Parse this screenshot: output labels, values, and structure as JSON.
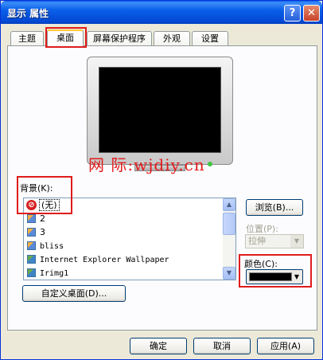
{
  "window": {
    "title": "显示 属性",
    "help_glyph": "?",
    "close_glyph": "✕"
  },
  "tabs": [
    {
      "label": "主题",
      "active": false
    },
    {
      "label": "桌面",
      "active": true
    },
    {
      "label": "屏幕保护程序",
      "active": false
    },
    {
      "label": "外观",
      "active": false
    },
    {
      "label": "设置",
      "active": false
    }
  ],
  "watermark": "网 际:wjdiy.cn",
  "background": {
    "label": "背景(K):",
    "items": [
      {
        "label": "(无)",
        "icon": "no-entry-icon",
        "selected": true
      },
      {
        "label": "2",
        "icon": "image-file-icon"
      },
      {
        "label": "3",
        "icon": "image-file-icon"
      },
      {
        "label": "bliss",
        "icon": "image-file-icon"
      },
      {
        "label": "Internet Explorer Wallpaper",
        "icon": "bitmap-file-icon"
      },
      {
        "label": "Irimg1",
        "icon": "bitmap-file-icon"
      }
    ]
  },
  "browse_button": "浏览(B)...",
  "position": {
    "label": "位置(P):",
    "value": "拉伸",
    "disabled": true
  },
  "color": {
    "label": "颜色(C):",
    "value": "#000000"
  },
  "customize_button": "自定义桌面(D)...",
  "footer": {
    "ok": "确定",
    "cancel": "取消",
    "apply": "应用(A)"
  },
  "colors": {
    "title_bar": "#0a5fe8",
    "highlight_annotation": "#e01b1b",
    "dialog_bg": "#ece9d8"
  }
}
